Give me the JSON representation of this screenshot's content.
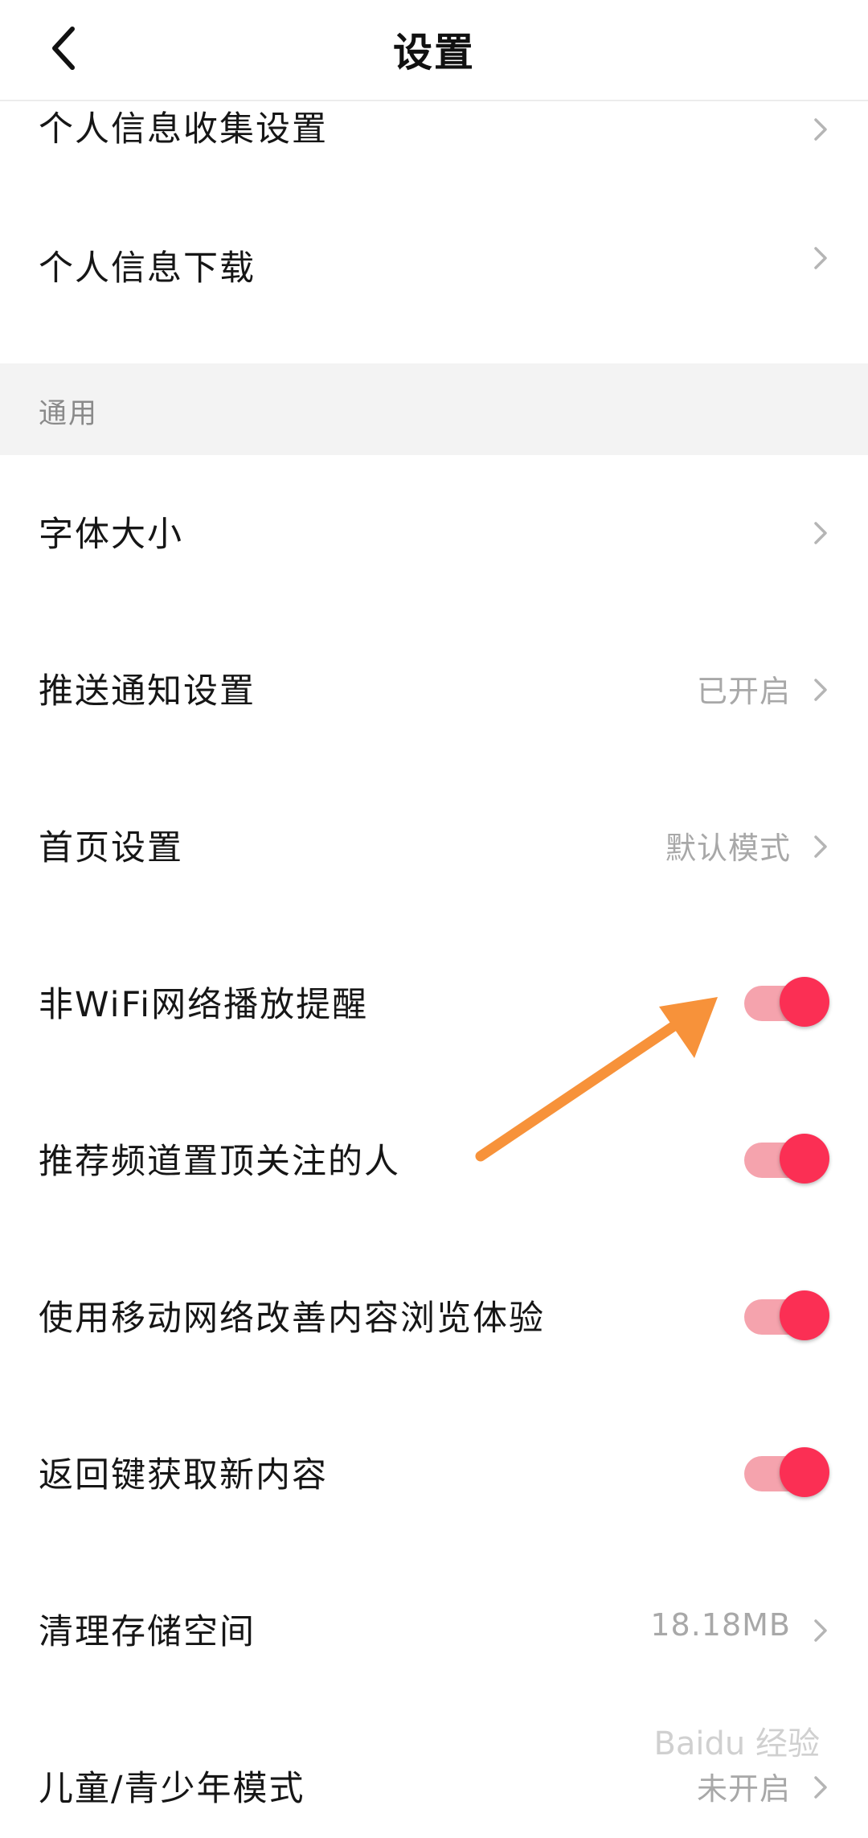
{
  "header": {
    "title": "设置",
    "back_icon": "chevron-left-icon"
  },
  "rows_top": [
    {
      "label": "个人信息收集设置"
    },
    {
      "label": "个人信息下载"
    }
  ],
  "section": {
    "title": "通用"
  },
  "rows_general": [
    {
      "label": "字体大小",
      "value": ""
    },
    {
      "label": "推送通知设置",
      "value": "已开启"
    },
    {
      "label": "首页设置",
      "value": "默认模式"
    }
  ],
  "toggles": [
    {
      "label": "非WiFi网络播放提醒",
      "on": true
    },
    {
      "label": "推荐频道置顶关注的人",
      "on": true
    },
    {
      "label": "使用移动网络改善内容浏览体验",
      "on": true
    },
    {
      "label": "返回键获取新内容",
      "on": true
    }
  ],
  "rows_bottom": [
    {
      "label": "清理存储空间",
      "value": "18.18MB"
    },
    {
      "label": "儿童/青少年模式",
      "value": "未开启"
    }
  ],
  "colors": {
    "toggle_on": "#fb2f54",
    "toggle_track": "#f5a3ad",
    "annotation_arrow": "#f7923a"
  },
  "watermark": "Baidu 经验"
}
